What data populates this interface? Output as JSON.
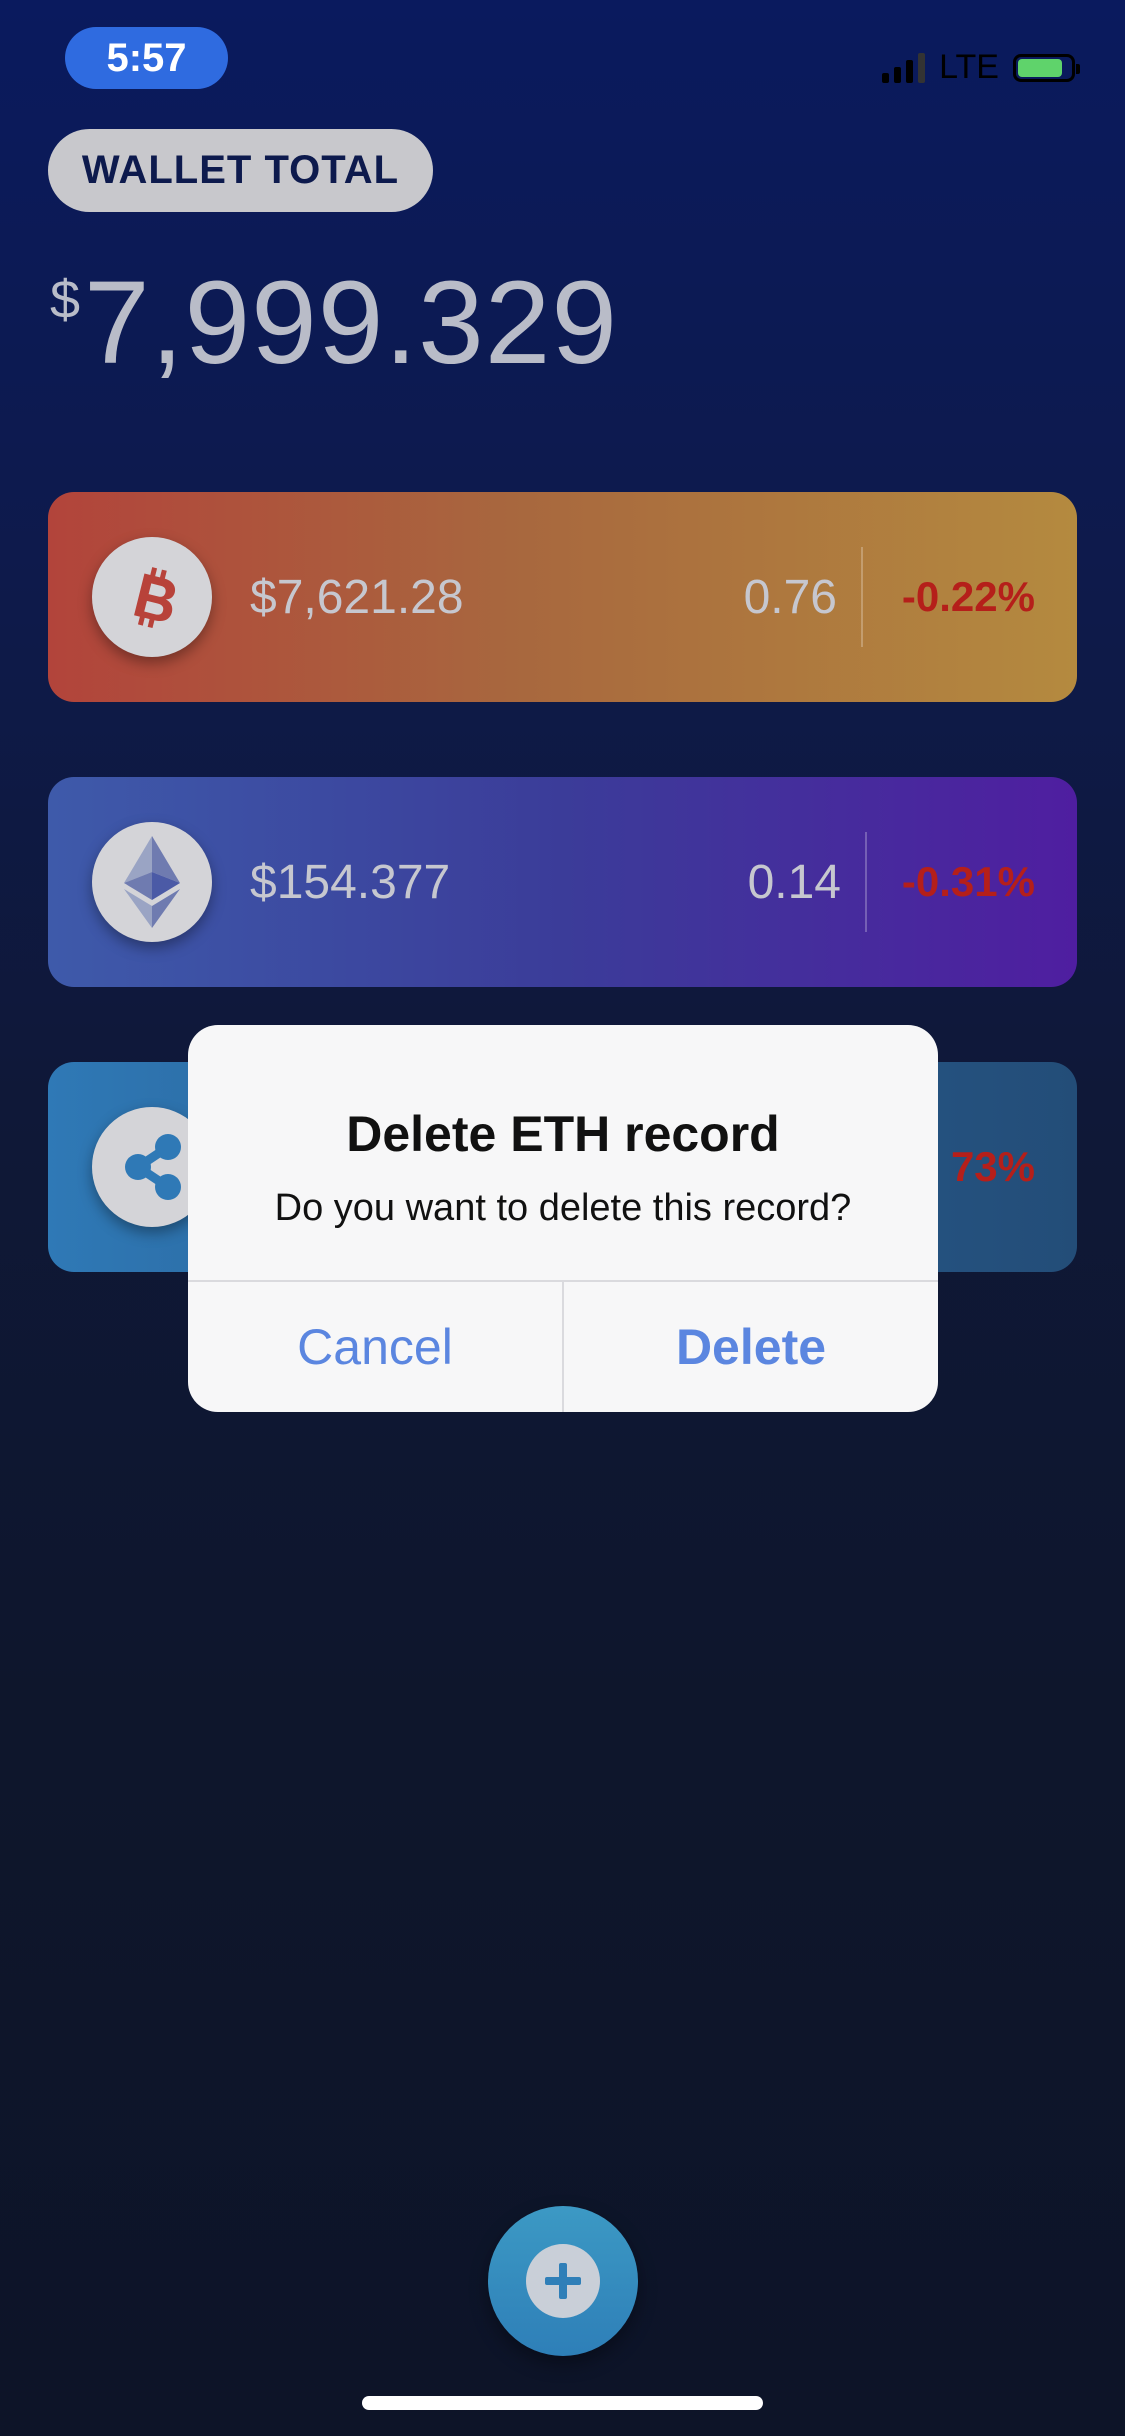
{
  "status_bar": {
    "time": "5:57",
    "network": "LTE",
    "battery_level": 0.85
  },
  "wallet": {
    "label": "WALLET TOTAL",
    "currency_symbol": "$",
    "total": "7,999.329"
  },
  "coins": [
    {
      "symbol": "BTC",
      "icon": "bitcoin-icon",
      "price": "$7,621.28",
      "quantity": "0.76",
      "change": "-0.22%"
    },
    {
      "symbol": "ETH",
      "icon": "ethereum-icon",
      "price": "$154.377",
      "quantity": "0.14",
      "change": "-0.31%"
    },
    {
      "symbol": "XRP",
      "icon": "ripple-icon",
      "price": "",
      "quantity": "",
      "change": "73%"
    }
  ],
  "dialog": {
    "title": "Delete ETH record",
    "message": "Do you want to delete this record?",
    "cancel_label": "Cancel",
    "delete_label": "Delete"
  },
  "fab": {
    "icon": "plus-icon"
  },
  "colors": {
    "accent": "#5b86e0",
    "negative": "#b51f1a",
    "time_pill": "#2f6be0"
  }
}
